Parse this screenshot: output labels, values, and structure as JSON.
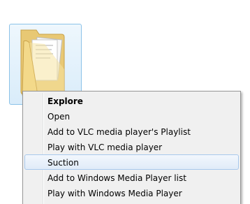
{
  "folder": {
    "name": ""
  },
  "context_menu": {
    "items": [
      {
        "label": "Explore",
        "default": true
      },
      {
        "label": "Open"
      },
      {
        "label": "Add to VLC media player's Playlist"
      },
      {
        "label": "Play with VLC media player"
      },
      {
        "label": "Suction",
        "highlighted": true
      },
      {
        "label": "Add to Windows Media Player list"
      },
      {
        "label": "Play with Windows Media Player"
      }
    ]
  },
  "colors": {
    "selection_border": "#8cc2e8",
    "menu_background": "#f0f0f0",
    "hover_border": "#a8c8ec"
  }
}
